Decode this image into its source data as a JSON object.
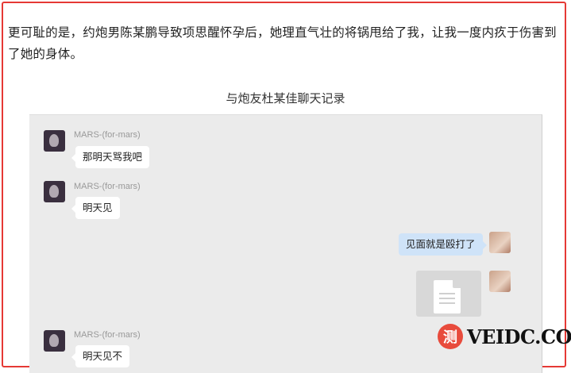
{
  "article": {
    "paragraph": "更可耻的是，约炮男陈某鹏导致项思醒怀孕后，她理直气壮的将锅甩给了我，让我一度内疚于伤害到了她的身体。",
    "caption": "与炮友杜某佳聊天记录"
  },
  "chat": {
    "messages": [
      {
        "sender": "MARS-(for-mars)",
        "text": "那明天骂我吧"
      },
      {
        "sender": "MARS-(for-mars)",
        "text": "明天见"
      },
      {
        "text": "见面就是殴打了"
      },
      {
        "type": "file",
        "icon": "document-icon"
      },
      {
        "sender": "MARS-(for-mars)",
        "text": "明天见不"
      }
    ]
  },
  "watermark": {
    "badge": "测",
    "text": "VEIDC.COM",
    "color": "#e84b3c"
  }
}
